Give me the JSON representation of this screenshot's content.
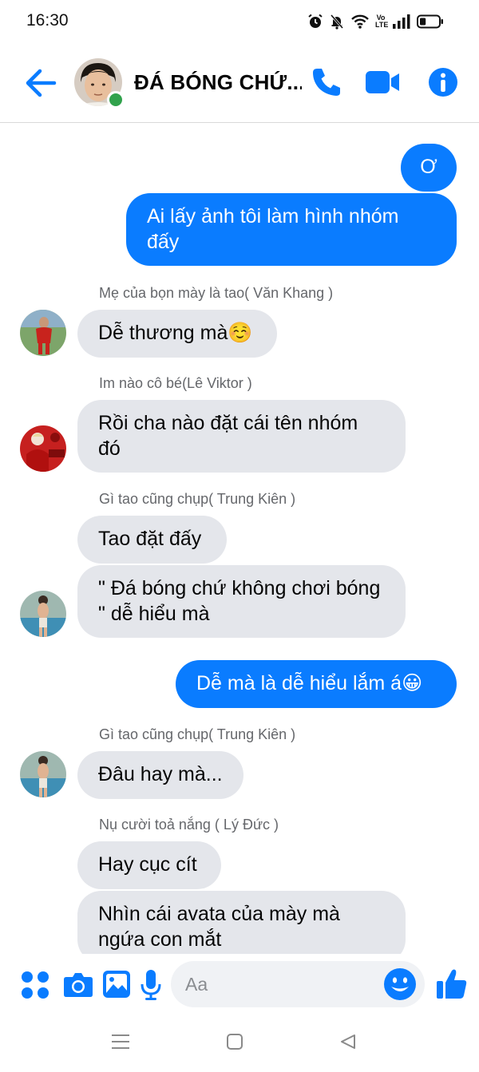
{
  "status_bar": {
    "time": "16:30",
    "network_type": "Vo LTE",
    "icons": [
      "alarm-icon",
      "mute-bell-icon",
      "wifi-icon",
      "volte-icon",
      "signal-icon",
      "battery-icon"
    ],
    "battery_level": 0.3
  },
  "header": {
    "title": "ĐÁ BÓNG CHỨ...",
    "online": true,
    "icons": [
      "back-arrow-icon",
      "phone-icon",
      "video-camera-icon",
      "info-icon"
    ]
  },
  "messages": [
    {
      "direction": "out",
      "text": "Ơ"
    },
    {
      "direction": "out",
      "text": "Ai lấy ảnh tôi làm hình nhóm đấy"
    },
    {
      "direction": "in",
      "sender": "Mẹ của bọn mày là tao( Văn Khang )",
      "text": "Dễ thương mà☺️"
    },
    {
      "direction": "in",
      "sender": "Im nào cô bé(Lê Viktor )",
      "text": "Rồi cha nào đặt cái tên nhóm đó"
    },
    {
      "direction": "in",
      "sender": "Gì tao cũng chụp( Trung Kiên )",
      "text": "Tao đặt đấy"
    },
    {
      "direction": "in",
      "text": "\" Đá bóng chứ không chơi bóng \" dễ hiểu mà"
    },
    {
      "direction": "out",
      "text": "Dễ mà là dễ hiểu lắm á😀"
    },
    {
      "direction": "in",
      "sender": "Gì tao cũng chụp( Trung Kiên )",
      "text": "Đâu hay mà..."
    },
    {
      "direction": "in",
      "sender": "Nụ cười toả nắng ( Lý Đức )",
      "text": "Hay cục cít"
    },
    {
      "direction": "in",
      "text": "Nhìn cái avata của mày mà ngứa con mắt"
    }
  ],
  "composer": {
    "placeholder": "Aa",
    "icons": [
      "grid-dots-icon",
      "camera-icon",
      "image-icon",
      "microphone-icon",
      "emoji-icon",
      "thumbs-up-icon"
    ]
  },
  "nav_bar": {
    "icons": [
      "recent-apps-icon",
      "home-icon",
      "back-triangle-icon"
    ]
  },
  "colors": {
    "accent": "#0a7cff",
    "incoming_bubble": "#e4e6eb",
    "online": "#31a24c",
    "sender_name": "#65676b"
  }
}
